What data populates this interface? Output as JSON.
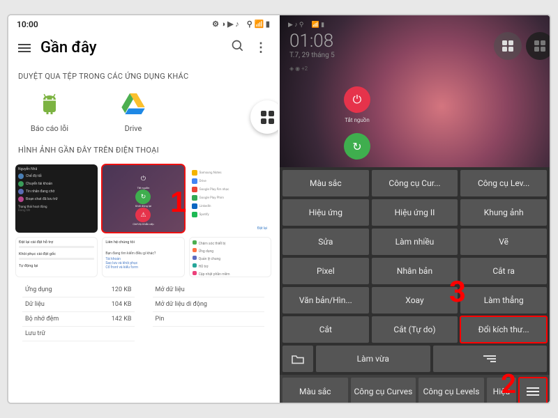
{
  "left": {
    "status_time": "10:00",
    "header_title": "Gần đây",
    "section_apps": "DUYỆT QUA TỆP TRONG CÁC ỨNG DỤNG KHÁC",
    "app1": "Báo cáo lỗi",
    "app2": "Drive",
    "section_recent": "HÌNH ẢNH GẦN ĐÂY TRÊN ĐIỆN THOẠI",
    "thumb2_btn1": "Tắt nguồn",
    "thumb2_btn2": "Khởi động lại",
    "thumb2_btn3": "Chế độ Khẩn cấp",
    "card1_h": "Đặt lại cài đặt hỗ trợ",
    "card2_h": "Khôi phục cài đặt gốc",
    "card3_h": "Tự động lại",
    "card4_h": "Liên hệ chúng tôi",
    "card5_h": "Bạn đang tìm kiếm điều gì khác?",
    "card5_a": "Tài khoản",
    "card5_b": "Sao lưu và khôi phục",
    "card5_c": "Cổ front và kiểu form",
    "card6_h": "Chăm sóc thiết bị",
    "card7_h": "Ứng dụng",
    "card8_h": "Quản lý chung",
    "card9_h": "Hỗ trợ",
    "card10_h": "Cập nhật phần mềm",
    "list1": "Ứng dụng",
    "list2": "Dữ liệu",
    "list3": "Bộ nhớ đệm",
    "list4": "Lưu trữ",
    "list_r1": "Mở dữ liệu",
    "list_r2": "Mở dữ liệu di động",
    "list_r3": "Pin",
    "size1": "120 KB",
    "size2": "104 KB",
    "size3": "142 KB"
  },
  "right": {
    "time": "01:08",
    "date": "T.7, 29 tháng 5",
    "power_off": "Tắt nguồn",
    "tools": {
      "r1c1": "Màu sắc",
      "r1c2": "Công cụ Cur...",
      "r1c3": "Công cụ Lev...",
      "r2c1": "Hiệu ứng",
      "r2c2": "Hiệu ứng II",
      "r2c3": "Khung ảnh",
      "r3c1": "Sửa",
      "r3c2": "Làm nhiều",
      "r3c3": "Vẽ",
      "r4c1": "Pixel",
      "r4c2": "Nhân bản",
      "r4c3": "Cắt ra",
      "r5c1": "Văn bản/Hìn...",
      "r5c2": "Xoay",
      "r5c3": "Làm thẳng",
      "r6c1": "Cắt",
      "r6c2": "Cắt (Tự do)",
      "r6c3": "Đổi kích thư...",
      "fit": "Làm vừa"
    },
    "bottom": {
      "b1": "Màu sắc",
      "b2": "Công cụ Curves",
      "b3": "Công cụ Levels",
      "b4": "Hiệu"
    }
  },
  "annotations": {
    "a1": "1",
    "a2": "2",
    "a3": "3"
  }
}
